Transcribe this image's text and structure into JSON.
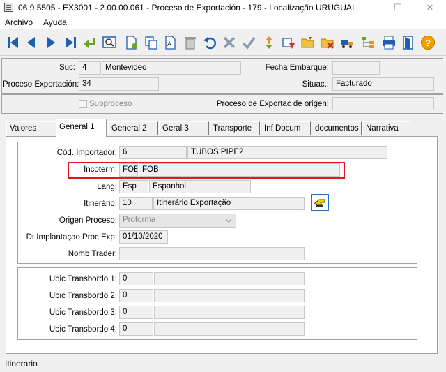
{
  "window": {
    "title": "06.9.5505 - EX3001 - 2.00.00.061 - Proceso de Exportación - 179 - Localização URUGUAI",
    "minimize": "—",
    "maximize": "☐",
    "close": "✕"
  },
  "menu": {
    "archivo": "Archivo",
    "ayuda": "Ayuda"
  },
  "toolbar": {
    "icons": [
      "first-icon",
      "prev-icon",
      "next-icon",
      "last-icon",
      "return-icon",
      "search-icon",
      "new-icon",
      "copy-icon",
      "edit-icon",
      "delete-icon",
      "undo-icon",
      "cancel-icon",
      "confirm-icon",
      "sort-icon",
      "transfer-icon",
      "folder-icon",
      "delete-folder-icon",
      "truck-icon",
      "tree-icon",
      "print-icon",
      "exit-icon",
      "help-icon"
    ]
  },
  "header": {
    "suc_label": "Suc:",
    "suc_code": "4",
    "suc_name": "Montevideo",
    "fecha_embarque_label": "Fecha Embarque:",
    "fecha_embarque_value": "",
    "proceso_label": "Proceso Exportación:",
    "proceso_value": "34",
    "situac_label": "Situac.:",
    "situac_value": "Facturado",
    "subproceso_label": "Subproceso",
    "proceso_origen_label": "Proceso de Exportac de origen:",
    "proceso_origen_value": ""
  },
  "tabs": [
    "Valores",
    "General 1",
    "General 2",
    "Geral 3",
    "Transporte",
    "Inf Docum",
    "documentos",
    "Narrativa"
  ],
  "active_tab": "General 1",
  "general1": {
    "importador_label": "Cód. Importador:",
    "importador_code": "6",
    "importador_name": "TUBOS PIPE2",
    "incoterm_label": "Incoterm:",
    "incoterm_code": "FOB",
    "incoterm_name": "FOB",
    "lang_label": "Lang:",
    "lang_code": "Esp",
    "lang_name": "Espanhol",
    "itinerario_label": "Itinerário:",
    "itinerario_code": "10",
    "itinerario_name": "Itinerário Exportação",
    "origen_label": "Origen Proceso:",
    "origen_value": "Proforma",
    "dt_label": "Dt Implantaçao Proc Exp:",
    "dt_value": "01/10/2020",
    "trader_label": "Nomb Trader:",
    "trader_value": "",
    "transbordo": [
      {
        "label": "Ubic Transbordo 1:",
        "code": "0",
        "name": ""
      },
      {
        "label": "Ubic Transbordo 2:",
        "code": "0",
        "name": ""
      },
      {
        "label": "Ubic Transbordo 3:",
        "code": "0",
        "name": ""
      },
      {
        "label": "Ubic Transbordo 4:",
        "code": "0",
        "name": ""
      }
    ]
  },
  "status_bar": {
    "text": "Itinerario"
  },
  "colors": {
    "highlight": "#e8141a",
    "accent": "#1e5fb0",
    "window_bg": "#f0f0f0"
  }
}
